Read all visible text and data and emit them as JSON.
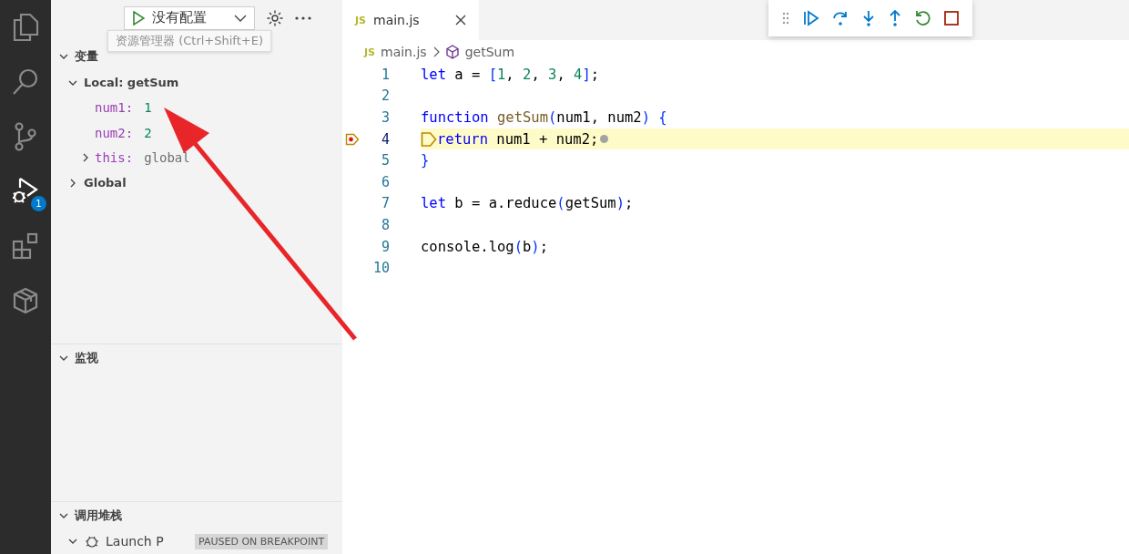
{
  "activity_bar": [
    {
      "kind": "files",
      "selected": false
    },
    {
      "kind": "search",
      "selected": false
    },
    {
      "kind": "source-control",
      "selected": false
    },
    {
      "kind": "debug",
      "selected": true,
      "badge": "1"
    },
    {
      "kind": "extensions",
      "selected": false
    },
    {
      "kind": "box",
      "selected": false
    }
  ],
  "tooltip": "资源管理器 (Ctrl+Shift+E)",
  "run_toolbar": {
    "configuration": "没有配置"
  },
  "sidebar": {
    "sections": [
      {
        "title": "变量",
        "expanded": true,
        "kind": "variables",
        "scopes": [
          {
            "label": "Local: getSum",
            "expanded": true,
            "children": [
              {
                "name": "num1:",
                "value": "1",
                "color": "#098658"
              },
              {
                "name": "num2:",
                "value": "2",
                "color": "#098658"
              },
              {
                "name": "this:",
                "value": "global",
                "color": "#6f6f6f",
                "expanded": false
              }
            ]
          },
          {
            "label": "Global",
            "expanded": false
          }
        ]
      },
      {
        "title": "监视",
        "expanded": true,
        "kind": "watch"
      },
      {
        "title": "调用堆栈",
        "expanded": true,
        "kind": "callstack",
        "sessions": [
          {
            "label": "Launch P",
            "expanded": true,
            "state": "PAUSED ON BREAKPOINT"
          }
        ]
      }
    ]
  },
  "tabs": [
    {
      "icon_text": "JS",
      "label": "main.js",
      "selected": true
    }
  ],
  "debug_toolbar": [
    {
      "kind": "continue"
    },
    {
      "kind": "step-over"
    },
    {
      "kind": "step-into"
    },
    {
      "kind": "step-out"
    },
    {
      "kind": "restart"
    },
    {
      "kind": "stop"
    }
  ],
  "breadcrumb": {
    "file_icon": "JS",
    "file": "main.js",
    "symbol": "getSum"
  },
  "code": [
    {
      "number": "1",
      "tokens": [
        {
          "text": "let",
          "kind": "keyword"
        },
        {
          "text": " a = ",
          "kind": "plain"
        },
        {
          "text": "[",
          "kind": "bracket"
        },
        {
          "text": "1",
          "kind": "number"
        },
        {
          "text": ", ",
          "kind": "plain"
        },
        {
          "text": "2",
          "kind": "number"
        },
        {
          "text": ", ",
          "kind": "plain"
        },
        {
          "text": "3",
          "kind": "number"
        },
        {
          "text": ", ",
          "kind": "plain"
        },
        {
          "text": "4",
          "kind": "number"
        },
        {
          "text": "]",
          "kind": "bracket"
        },
        {
          "text": ";",
          "kind": "plain"
        }
      ]
    },
    {
      "number": "2"
    },
    {
      "number": "3",
      "tokens": [
        {
          "text": "function",
          "kind": "keyword"
        },
        {
          "text": " getSum",
          "kind": "function"
        },
        {
          "text": "(",
          "kind": "bracket"
        },
        {
          "text": "num1, num2",
          "kind": "plain"
        },
        {
          "text": ") {",
          "kind": "bracket"
        }
      ]
    },
    {
      "number": "4",
      "current": true,
      "breakpoint": true,
      "tokens": [
        {
          "text": "return",
          "kind": "keyword"
        },
        {
          "text": " num1 + num2;",
          "kind": "plain"
        }
      ]
    },
    {
      "number": "5",
      "tokens": [
        {
          "text": "}",
          "kind": "bracket"
        }
      ]
    },
    {
      "number": "6"
    },
    {
      "number": "7",
      "tokens": [
        {
          "text": "let",
          "kind": "keyword"
        },
        {
          "text": " b = a.reduce",
          "kind": "plain"
        },
        {
          "text": "(",
          "kind": "bracket"
        },
        {
          "text": "getSum",
          "kind": "plain"
        },
        {
          "text": ")",
          "kind": "bracket"
        },
        {
          "text": ";",
          "kind": "plain"
        }
      ]
    },
    {
      "number": "8"
    },
    {
      "number": "9",
      "tokens": [
        {
          "text": "console.log",
          "kind": "plain"
        },
        {
          "text": "(",
          "kind": "bracket"
        },
        {
          "text": "b",
          "kind": "plain"
        },
        {
          "text": ")",
          "kind": "bracket"
        },
        {
          "text": ";",
          "kind": "plain"
        }
      ]
    },
    {
      "number": "10"
    }
  ]
}
